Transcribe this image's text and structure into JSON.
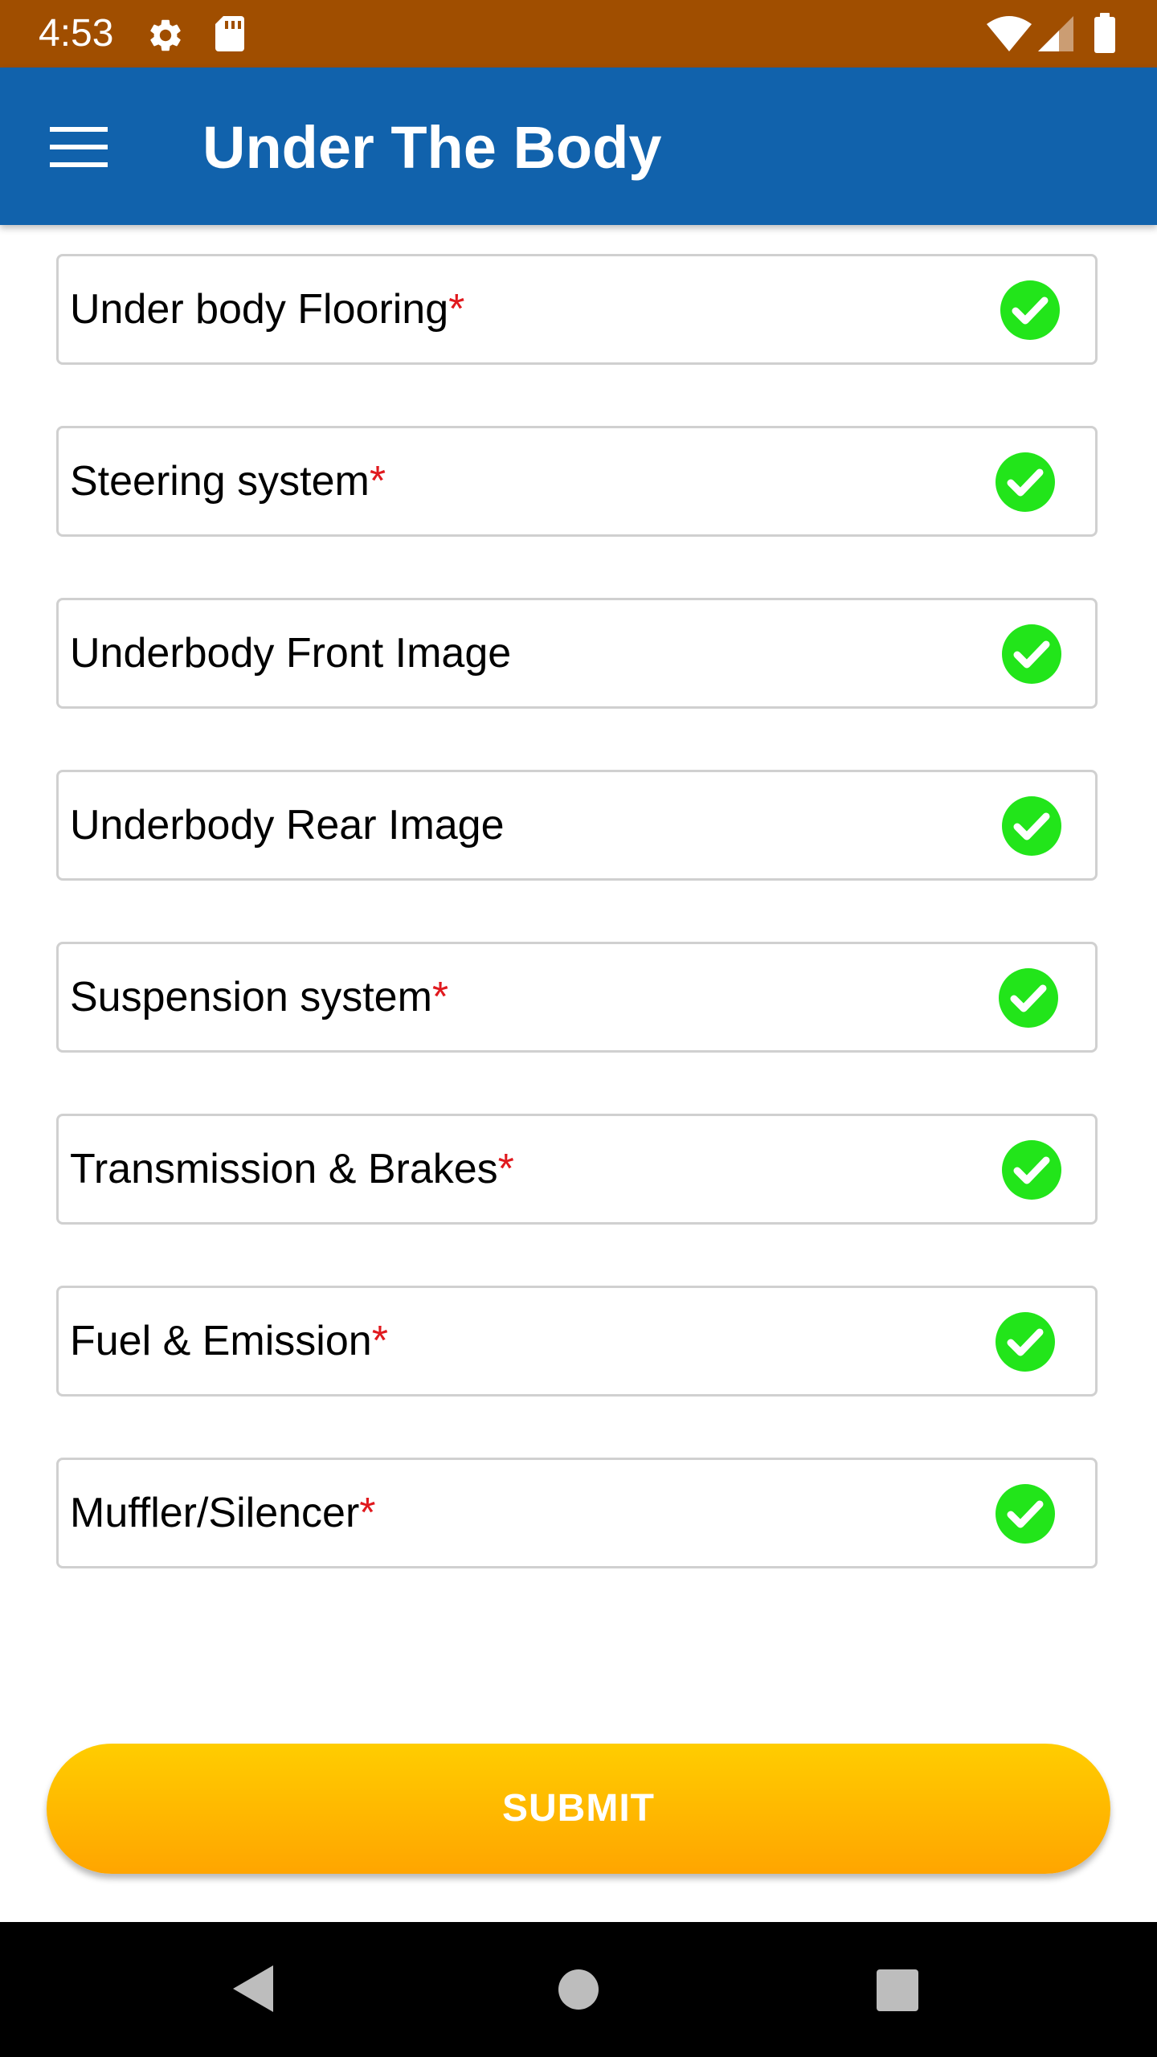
{
  "status_bar": {
    "time": "4:53",
    "icons": [
      "gear-icon",
      "sd-card-icon",
      "wifi-icon",
      "cell-signal-icon",
      "battery-icon"
    ]
  },
  "app_bar": {
    "menu_icon": "hamburger-menu-icon",
    "title": "Under The Body"
  },
  "items": [
    {
      "label": "Under body Flooring",
      "required": "*",
      "status_icon": "check-circle-icon"
    },
    {
      "label": "Steering system",
      "required": "*",
      "status_icon": "check-circle-icon"
    },
    {
      "label": "Underbody Front Image",
      "required": "",
      "status_icon": "check-circle-icon"
    },
    {
      "label": "Underbody Rear Image",
      "required": "",
      "status_icon": "check-circle-icon"
    },
    {
      "label": "Suspension system",
      "required": "*",
      "status_icon": "check-circle-icon"
    },
    {
      "label": "Transmission & Brakes",
      "required": "*",
      "status_icon": "check-circle-icon"
    },
    {
      "label": "Fuel & Emission",
      "required": "*",
      "status_icon": "check-circle-icon"
    },
    {
      "label": "Muffler/Silencer",
      "required": "*",
      "status_icon": "check-circle-icon"
    }
  ],
  "submit_label": "SUBMIT",
  "nav_bar": {
    "icons": [
      "back-icon",
      "home-icon",
      "recents-icon"
    ]
  },
  "colors": {
    "status_bar": "#a04e00",
    "app_bar": "#1162ac",
    "check": "#22e51a",
    "required": "#e0191e",
    "submit_top": "#ffcd00",
    "submit_bottom": "#ffa500"
  }
}
